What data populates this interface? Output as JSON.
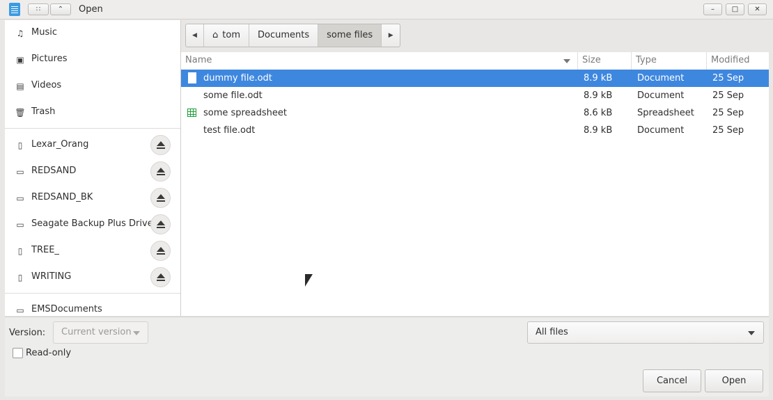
{
  "window": {
    "title": "Open",
    "grid_btn": "∷",
    "up_btn": "⌃",
    "minimize": "–",
    "maximize": "□",
    "close": "✕"
  },
  "sidebar": {
    "places": [
      {
        "label": "Music",
        "icon": "music-note-icon",
        "glyph": "♫"
      },
      {
        "label": "Pictures",
        "icon": "picture-icon",
        "glyph": "▣"
      },
      {
        "label": "Videos",
        "icon": "film-icon",
        "glyph": "▤"
      },
      {
        "label": "Trash",
        "icon": "trash-icon",
        "glyph": "🗑"
      }
    ],
    "devices": [
      {
        "label": "Lexar_Orang",
        "icon": "usb-drive-icon",
        "glyph": "▯"
      },
      {
        "label": "REDSAND",
        "icon": "drive-icon",
        "glyph": "▭"
      },
      {
        "label": "REDSAND_BK",
        "icon": "drive-icon",
        "glyph": "▭"
      },
      {
        "label": "Seagate Backup Plus Drive",
        "icon": "drive-icon",
        "glyph": "▭"
      },
      {
        "label": "TREE_",
        "icon": "usb-drive-icon",
        "glyph": "▯"
      },
      {
        "label": "WRITING",
        "icon": "usb-drive-icon",
        "glyph": "▯"
      }
    ],
    "bookmarks": [
      {
        "label": "EMSDocuments",
        "icon": "drive-icon",
        "glyph": "▭"
      }
    ]
  },
  "pathbar": {
    "back_glyph": "◀",
    "forward_glyph": "▶",
    "home_glyph": "⌂",
    "crumbs": [
      "tom",
      "Documents",
      "some files"
    ]
  },
  "filelist": {
    "columns": {
      "name": "Name",
      "size": "Size",
      "type": "Type",
      "modified": "Modified"
    },
    "rows": [
      {
        "name": "dummy file.odt",
        "size": "8.9 kB",
        "type": "Document",
        "modified": "25 Sep",
        "icon": "document-icon"
      },
      {
        "name": "some file.odt",
        "size": "8.9 kB",
        "type": "Document",
        "modified": "25 Sep",
        "icon": "document-icon"
      },
      {
        "name": "some spreadsheet",
        "size": "8.6 kB",
        "type": "Spreadsheet",
        "modified": "25 Sep",
        "icon": "spreadsheet-icon"
      },
      {
        "name": "test file.odt",
        "size": "8.9 kB",
        "type": "Document",
        "modified": "25 Sep",
        "icon": "document-icon"
      }
    ],
    "selected_index": 0
  },
  "options": {
    "version_label": "Version:",
    "version_value": "Current version",
    "readonly_label": "Read-only",
    "filter_value": "All files"
  },
  "buttons": {
    "cancel": "Cancel",
    "open": "Open"
  },
  "colors": {
    "selection": "#3e87df",
    "app_icon": "#3a9be3",
    "spreadsheet_icon": "#1f9d3b"
  }
}
